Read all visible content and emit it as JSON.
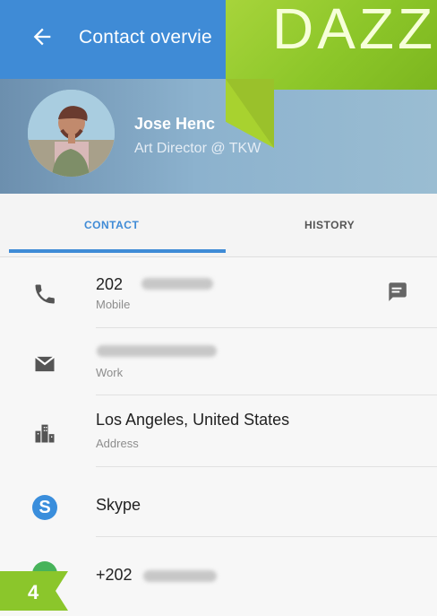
{
  "header": {
    "title": "Contact overvie"
  },
  "profile": {
    "name": "Jose Henc",
    "subtitle": "Art Director @ TKW"
  },
  "tabs": [
    {
      "label": "CONTACT"
    },
    {
      "label": "HISTORY"
    }
  ],
  "items": [
    {
      "value": "202",
      "label": "Mobile",
      "icon": "phone-icon"
    },
    {
      "value": "",
      "label": "Work",
      "icon": "mail-icon"
    },
    {
      "value": "Los Angeles, United States",
      "label": "Address",
      "icon": "building-icon"
    },
    {
      "value": "Skype",
      "label": "",
      "icon": "skype-icon"
    },
    {
      "value": "+202",
      "label": "",
      "icon": "whatsapp-icon"
    }
  ],
  "overlay": {
    "banner_text": "DAZZ",
    "badge_number": "4"
  },
  "colors": {
    "accent": "#3f8bd6",
    "green": "#8bc62b"
  }
}
